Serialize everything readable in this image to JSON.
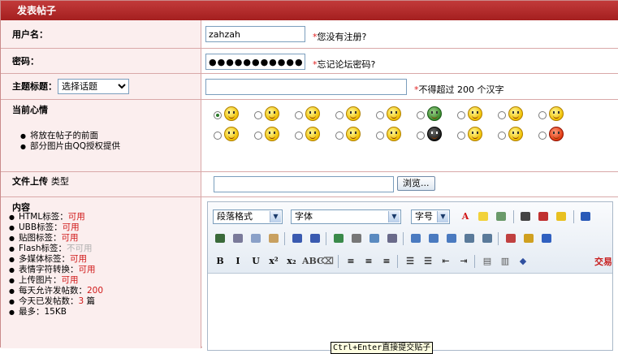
{
  "title": "发表帖子",
  "username": {
    "label": "用户名：",
    "value": "zahzah",
    "hint_star": "*",
    "hint": "您没有注册?"
  },
  "password": {
    "label": "密码：",
    "value": "●●●●●●●●●●●",
    "hint_star": "*",
    "hint": "忘记论坛密码?"
  },
  "subject": {
    "label": "主题标题：",
    "select_value": "选择话题",
    "value": "",
    "hint_star": "*",
    "hint": "不得超过 200 个汉字"
  },
  "mood": {
    "label": "当前心情",
    "notes": [
      "将放在帖子的前面",
      "部分图片由QQ授权提供"
    ],
    "selected_index": 0,
    "faces": [
      "smile-icon",
      "laugh-icon",
      "grin-icon",
      "love-icon",
      "tongue-icon",
      "soldier-icon",
      "cry-icon",
      "wink-icon",
      "surprise-icon",
      "blush-icon",
      "angry-icon",
      "sweat-icon",
      "shock-icon",
      "sly-icon",
      "cool-icon",
      "sad-icon",
      "hammer-icon",
      "devil-icon"
    ]
  },
  "upload": {
    "label": "文件上传",
    "type_label": "类型",
    "button": "浏览..."
  },
  "content": {
    "label": "内容",
    "rules": [
      {
        "name": "HTML标签：",
        "value": "可用",
        "status": "red"
      },
      {
        "name": "UBB标签：",
        "value": "可用",
        "status": "red"
      },
      {
        "name": "贴图标签：",
        "value": "可用",
        "status": "red"
      },
      {
        "name": "Flash标签：",
        "value": "不可用",
        "status": "grey"
      },
      {
        "name": "多媒体标签：",
        "value": "可用",
        "status": "red"
      },
      {
        "name": "表情字符转换：",
        "value": "可用",
        "status": "red"
      },
      {
        "name": "上传图片：",
        "value": "可用",
        "status": "red"
      },
      {
        "name": "每天允许发帖数：",
        "value": "200",
        "status": "red"
      },
      {
        "name": "今天已发帖数：",
        "value": "3",
        "status": "red",
        "suffix": " 篇"
      },
      {
        "name": "最多：15KB",
        "value": "",
        "status": "none"
      }
    ]
  },
  "editor": {
    "paragraph_select": "段落格式",
    "font_select": "字体",
    "size_select": "字号",
    "trade_label": "交易",
    "tooltip": "Ctrl+Enter直接提交贴子"
  }
}
